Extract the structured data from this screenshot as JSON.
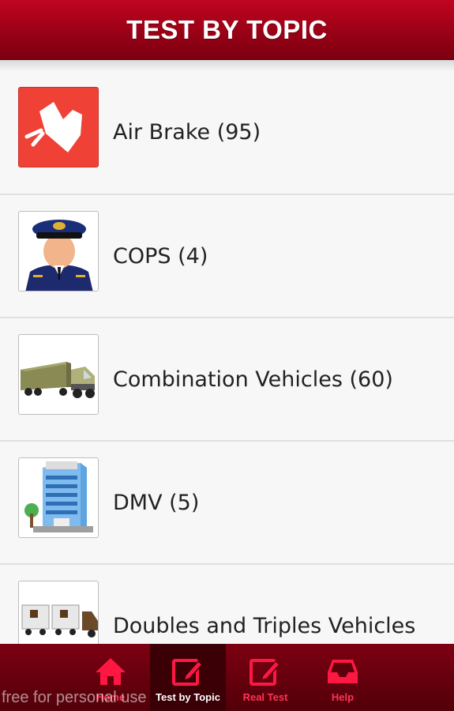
{
  "header": {
    "title": "TEST BY TOPIC"
  },
  "topics": [
    {
      "label": "Air Brake (95)",
      "icon": "air-brake-icon"
    },
    {
      "label": "COPS (4)",
      "icon": "police-officer-icon"
    },
    {
      "label": "Combination Vehicles (60)",
      "icon": "semi-truck-icon"
    },
    {
      "label": "DMV (5)",
      "icon": "dmv-building-icon"
    },
    {
      "label": "Doubles and Triples Vehicles",
      "icon": "double-trailer-truck-icon"
    }
  ],
  "tabs": [
    {
      "label": "Home",
      "icon": "home-icon"
    },
    {
      "label": "Test by Topic",
      "icon": "edit-icon"
    },
    {
      "label": "Real Test",
      "icon": "edit-icon"
    },
    {
      "label": "Help",
      "icon": "inbox-icon"
    }
  ],
  "watermark": "free for personal use",
  "colors": {
    "header": "#9a0017",
    "accent": "#ff1744",
    "air_brake_tile": "#ef4136"
  }
}
